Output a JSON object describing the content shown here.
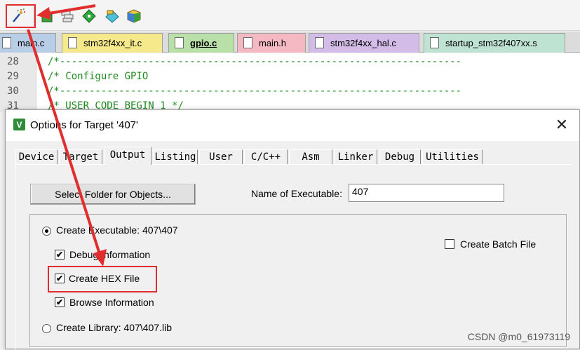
{
  "colors": {
    "accent_red": "#e12d2d",
    "code_comment": "#1f8a1f"
  },
  "toolbar": {
    "buttons": [
      {
        "icon": "magic-wand-icon"
      },
      {
        "icon": "build-target-icon"
      },
      {
        "icon": "stacked-windows-icon"
      },
      {
        "icon": "green-diamond-icon"
      },
      {
        "icon": "download-diamond-icon"
      },
      {
        "icon": "options-cube-icon"
      }
    ]
  },
  "file_tabs": [
    {
      "label": "main.c",
      "color": "#b8cde6"
    },
    {
      "label": "stm32f4xx_it.c",
      "color": "#f6e98c"
    },
    {
      "label": "gpio.c",
      "color": "#b9e0a8",
      "active": true
    },
    {
      "label": "main.h",
      "color": "#f4b9c2"
    },
    {
      "label": "stm32f4xx_hal.c",
      "color": "#d3bde8"
    },
    {
      "label": "startup_stm32f407xx.s",
      "color": "#bfe3d2"
    }
  ],
  "editor": {
    "lines": [
      {
        "num": "28",
        "text": "/*--------------------------------------------------------------------"
      },
      {
        "num": "29",
        "text": "/* Configure GPIO"
      },
      {
        "num": "30",
        "text": "/*--------------------------------------------------------------------"
      },
      {
        "num": "31",
        "text": "/* USER CODE BEGIN 1 */"
      }
    ]
  },
  "dialog": {
    "title": "Options for Target '407'",
    "tabs": [
      "Device",
      "Target",
      "Output",
      "Listing",
      "User",
      "C/C++",
      "Asm",
      "Linker",
      "Debug",
      "Utilities"
    ],
    "active_tab": "Output",
    "select_folder_label": "Select Folder for Objects...",
    "name_exec_label": "Name of Executable:",
    "name_exec_value": "407",
    "create_executable_label": "Create Executable:  407\\407",
    "create_executable_selected": true,
    "debug_info_label": "Debug Information",
    "debug_info_checked": true,
    "create_hex_label": "Create HEX File",
    "create_hex_checked": true,
    "browse_info_label": "Browse Information",
    "browse_info_checked": true,
    "create_library_label": "Create Library:  407\\407.lib",
    "create_library_selected": false,
    "create_batch_label": "Create Batch File",
    "create_batch_checked": false
  },
  "watermark": "CSDN @m0_61973119",
  "glyphs": {
    "check": "✔",
    "close": "✕",
    "dialog_icon": "V"
  }
}
